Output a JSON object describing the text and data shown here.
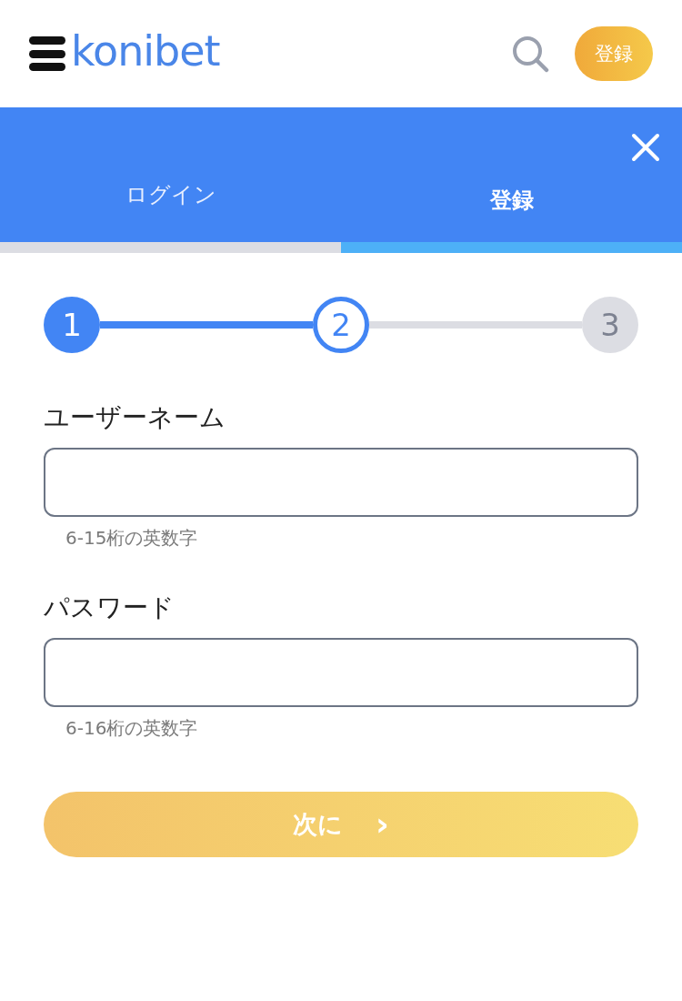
{
  "header": {
    "logo": "konibet",
    "register_button": "登録"
  },
  "tabs": [
    {
      "label": "ログイン",
      "selected": false
    },
    {
      "label": "登録",
      "selected": true
    }
  ],
  "steps": [
    {
      "label": "1",
      "kind": "done"
    },
    {
      "label": "2",
      "kind": "current"
    },
    {
      "label": "3",
      "kind": "upcoming"
    }
  ],
  "fields": [
    {
      "label": "ユーザーネーム",
      "hint": "6-15桁の英数字"
    },
    {
      "label": "パスワード",
      "hint": "6-16桁の英数字"
    }
  ],
  "next_button": {
    "label": "次に",
    "icon": "›"
  }
}
